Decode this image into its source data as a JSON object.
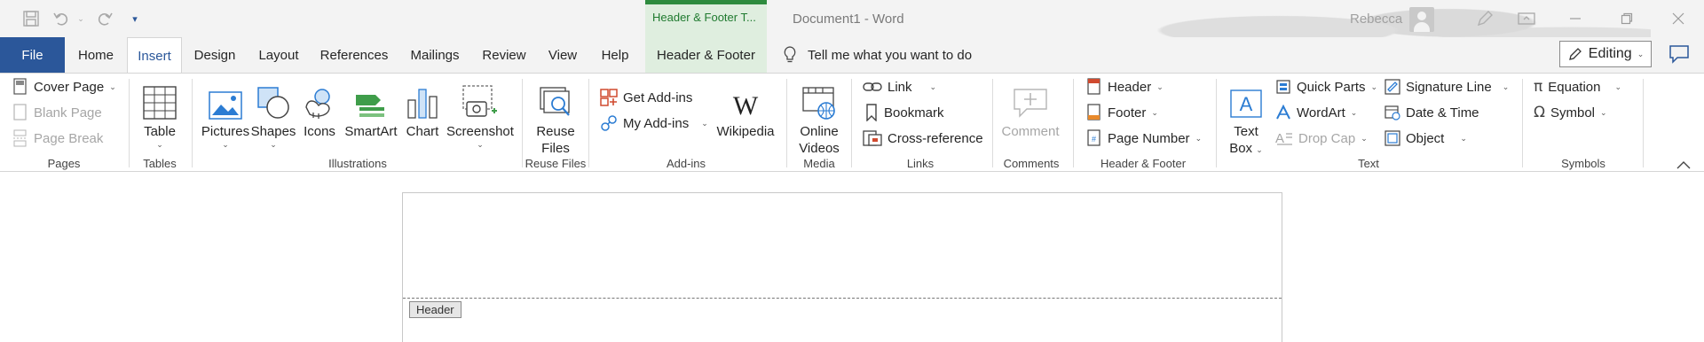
{
  "qat": {
    "save_icon": "save-icon",
    "undo_icon": "undo-icon",
    "redo_icon": "redo-icon",
    "customize_icon": "customize-qat-icon"
  },
  "contextual_tab_title": "Header & Footer T...",
  "document_title": "Document1  -  Word",
  "user": {
    "name": "Rebecca"
  },
  "window": {
    "minimize": "minimize-icon",
    "restore": "restore-icon",
    "close": "close-icon"
  },
  "tabs": [
    "File",
    "Home",
    "Insert",
    "Design",
    "Layout",
    "References",
    "Mailings",
    "Review",
    "View",
    "Help",
    "Header & Footer"
  ],
  "active_tab": "Insert",
  "tell_me": "Tell me what you want to do",
  "editing_label": "Editing",
  "ribbon": {
    "pages": {
      "label": "Pages",
      "cover_page": "Cover Page",
      "blank_page": "Blank Page",
      "page_break": "Page Break"
    },
    "tables": {
      "label": "Tables",
      "table": "Table"
    },
    "illustrations": {
      "label": "Illustrations",
      "pictures": "Pictures",
      "shapes": "Shapes",
      "icons": "Icons",
      "smartart": "SmartArt",
      "chart": "Chart",
      "screenshot": "Screenshot"
    },
    "reuse_files": {
      "label": "Reuse Files",
      "line1": "Reuse",
      "line2": "Files"
    },
    "addins": {
      "label": "Add-ins",
      "get_addins": "Get Add-ins",
      "my_addins": "My Add-ins",
      "wikipedia": "Wikipedia"
    },
    "media": {
      "label": "Media",
      "line1": "Online",
      "line2": "Videos"
    },
    "links": {
      "label": "Links",
      "link": "Link",
      "bookmark": "Bookmark",
      "cross_reference": "Cross-reference"
    },
    "comments": {
      "label": "Comments",
      "comment": "Comment"
    },
    "header_footer": {
      "label": "Header & Footer",
      "header": "Header",
      "footer": "Footer",
      "page_number": "Page Number"
    },
    "text": {
      "label": "Text",
      "text_box_line1": "Text",
      "text_box_line2": "Box",
      "quick_parts": "Quick Parts",
      "wordart": "WordArt",
      "drop_cap": "Drop Cap",
      "signature_line": "Signature Line",
      "date_time": "Date & Time",
      "object": "Object"
    },
    "symbols": {
      "label": "Symbols",
      "equation": "Equation",
      "symbol": "Symbol"
    }
  },
  "document": {
    "header_tag": "Header"
  },
  "colors": {
    "file_tab": "#2b579a",
    "contextual": "#dfeedf",
    "contextual_bar": "#2e8b3e"
  }
}
